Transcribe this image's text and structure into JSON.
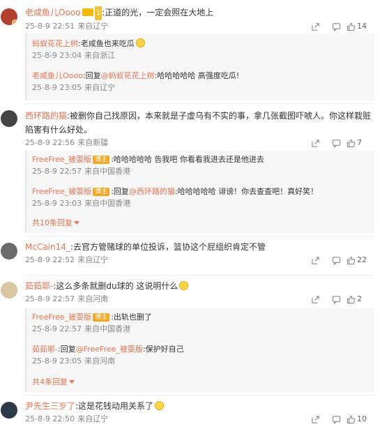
{
  "icons": {
    "share": "share-icon",
    "comment": "comment-icon",
    "like": "like-icon"
  },
  "comments": [
    {
      "user": "老咸鱼儿Oooo",
      "text": ":正道的光，一定会照在大地上",
      "time": "25-8-9 22:51",
      "location": "来自辽宁",
      "likes": "14",
      "replies": [
        {
          "user": "蚂蚁花花上树",
          "text": ":老咸鱼也来吃瓜",
          "time": "25-8-9 23:04",
          "location": "来自浙江"
        },
        {
          "user": "老咸鱼儿Oooo",
          "prefix": ":回复",
          "mention": "@蚂蚁花花上树",
          "text": ":哈哈哈哈哈 高强度吃瓜!",
          "time": "25-8-9 23:05",
          "location": "来自辽宁"
        }
      ]
    },
    {
      "user": "西环路的猫",
      "text": ":被删你自己找原因，本来就是子虚乌有不实的事，拿几张截图吓唬人。你这样栽赃陷害有什么好处。",
      "time": "25-8-9 22:56",
      "location": "来自新疆",
      "likes": "7",
      "replies": [
        {
          "user": "FreeFree_被耍版",
          "badge": "博主",
          "text": ":哈哈哈哈哈 告我吧 你看看我进去还是他进去",
          "time": "25-8-9 22:57",
          "location": "来自中国香港"
        },
        {
          "user": "FreeFree_被耍版",
          "badge": "博主",
          "prefix": ":回复",
          "mention": "@西环路的猫",
          "text": ":哈哈哈哈哈 诽谤！你去查查吧！真好笑！",
          "time": "25-8-9 23:03",
          "location": "来自中国香港"
        }
      ],
      "more": "共10条回复"
    },
    {
      "user": "McCain14_",
      "text": ":去官方管赌球的单位投诉，篮协这个屁组织肯定不管",
      "time": "25-8-9 22:52",
      "location": "来自辽宁",
      "likes": "22"
    },
    {
      "user": "茹茹耶-",
      "text": ":这么多条就删du球的 这说明什么",
      "time": "25-8-9 22:57",
      "location": "来自河南",
      "likes": "2",
      "replies": [
        {
          "user": "FreeFree_被耍版",
          "badge": "博主",
          "text": ":出轨也删了",
          "time": "25-8-9 22:57",
          "location": "来自中国香港"
        },
        {
          "user": "茹茹耶-",
          "prefix": ":回复",
          "mention": "@FreeFree_被耍版",
          "text": ":保护好自己",
          "time": "25-8-9 23:05",
          "location": "来自河南"
        }
      ],
      "more": "共4条回复"
    },
    {
      "user": "尹先生三岁了",
      "text": ":这是花钱动用关系了",
      "time": "25-8-9 22:50",
      "location": "来自辽宁",
      "likes": "10"
    }
  ]
}
